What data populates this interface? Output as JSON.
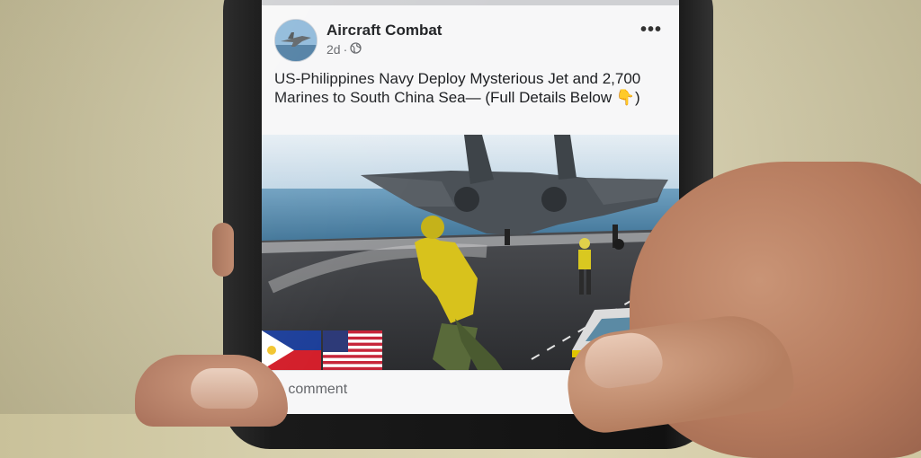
{
  "post": {
    "page_name": "Aircraft Combat",
    "timestamp": "2d",
    "separator": "·",
    "caption_text": "US-Philippines Navy Deploy Mysterious Jet and 2,700 Marines to South China Sea— (Full Details Below ",
    "caption_emoji": "👇",
    "caption_end": ")",
    "more_label": "•••",
    "comments_label": "1 comment"
  },
  "icons": {
    "privacy": "globe-icon",
    "more": "more-options-icon"
  },
  "colors": {
    "sky": "#cfe0ee",
    "sea": "#5d93b5",
    "deck": "#3a3b3e",
    "vest": "#d7c41d"
  }
}
